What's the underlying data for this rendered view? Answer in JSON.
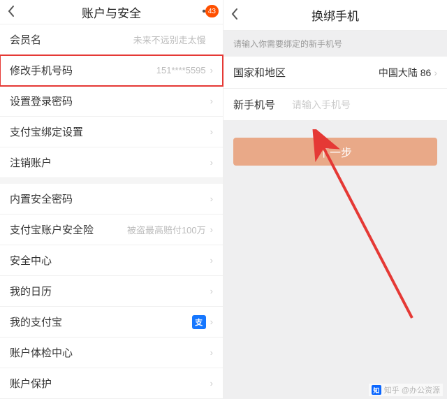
{
  "left": {
    "title": "账户与安全",
    "badge_count": "43",
    "rows": [
      {
        "label": "会员名",
        "value": "未来不远别走太慢",
        "arrow": false,
        "highlight": false
      },
      {
        "label": "修改手机号码",
        "value": "151****5595",
        "arrow": true,
        "highlight": true
      },
      {
        "label": "设置登录密码",
        "value": "",
        "arrow": true,
        "highlight": false
      },
      {
        "label": "支付宝绑定设置",
        "value": "",
        "arrow": true,
        "highlight": false
      },
      {
        "label": "注销账户",
        "value": "",
        "arrow": true,
        "highlight": false
      }
    ],
    "rows2": [
      {
        "label": "内置安全密码",
        "value": "",
        "arrow": true
      },
      {
        "label": "支付宝账户安全险",
        "value": "被盗最高赔付100万",
        "arrow": true
      },
      {
        "label": "安全中心",
        "value": "",
        "arrow": true
      },
      {
        "label": "我的日历",
        "value": "",
        "arrow": true
      },
      {
        "label": "我的支付宝",
        "value": "",
        "alipay_badge": "支",
        "arrow": true
      },
      {
        "label": "账户体检中心",
        "value": "",
        "arrow": true
      },
      {
        "label": "账户保护",
        "value": "",
        "arrow": true
      }
    ]
  },
  "right": {
    "title": "换绑手机",
    "hint": "请输入你需要绑定的新手机号",
    "region_label": "国家和地区",
    "region_value": "中国大陆 86",
    "phone_label": "新手机号",
    "phone_placeholder": "请输入手机号",
    "next_button": "下一步"
  },
  "watermark": "知乎 @办公资源"
}
